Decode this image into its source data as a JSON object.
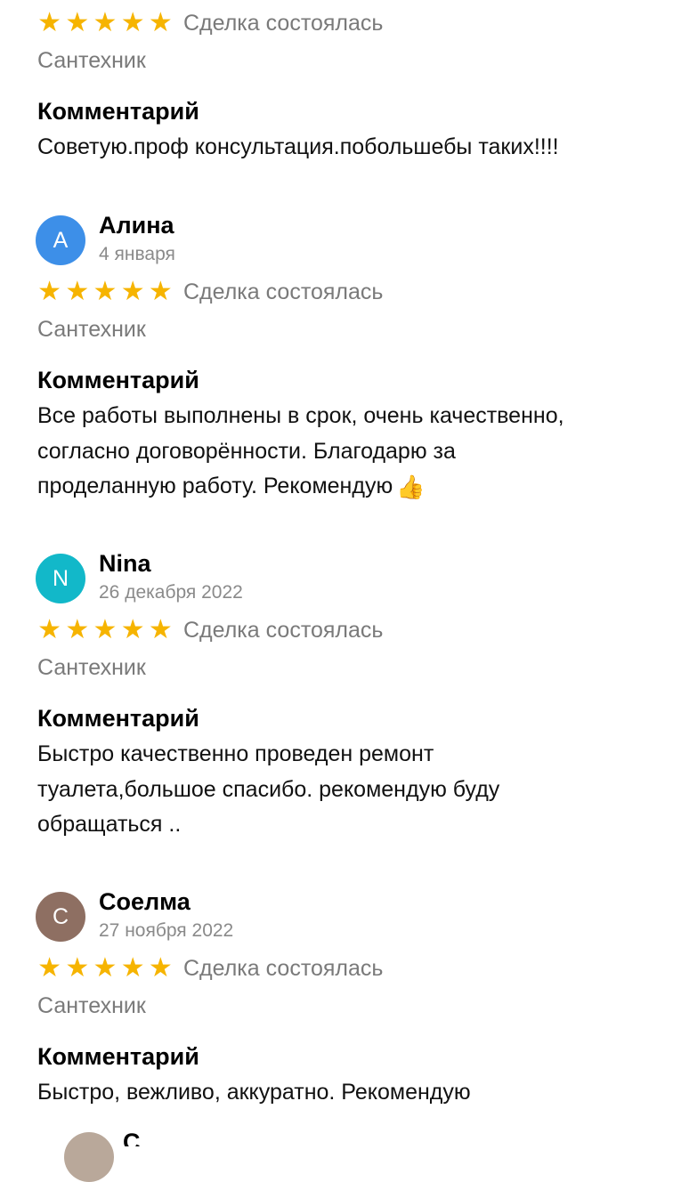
{
  "colors": {
    "star": "#f6b400",
    "secondary_text": "#7a7a7a",
    "avatar_alina": "#3d8fe8",
    "avatar_nina": "#12b8c9",
    "avatar_soelma": "#8e6f62"
  },
  "reviews": [
    {
      "rating": 5,
      "deal_status": "Сделка состоялась",
      "category": "Сантехник",
      "comment_heading": "Комментарий",
      "comment_lines": [
        "Советую.проф консультация.побольшебы таких!!!!"
      ]
    },
    {
      "avatar_letter": "А",
      "author": "Алина",
      "date": "4 января",
      "rating": 5,
      "deal_status": "Сделка состоялась",
      "category": "Сантехник",
      "comment_heading": "Комментарий",
      "comment_lines": [
        "Все работы выполнены в срок, очень качественно,",
        "согласно договорённости. Благодарю за",
        "проделанную работу. Рекомендую"
      ],
      "comment_emoji": "👍"
    },
    {
      "avatar_letter": "N",
      "author": "Nina",
      "date": "26 декабря 2022",
      "rating": 5,
      "deal_status": "Сделка состоялась",
      "category": "Сантехник",
      "comment_heading": "Комментарий",
      "comment_lines": [
        "Быстро качественно проведен ремонт",
        "туалета,большое спасибо. рекомендую буду",
        "обращаться .."
      ]
    },
    {
      "avatar_letter": "С",
      "author": "Соелма",
      "date": "27 ноября 2022",
      "rating": 5,
      "deal_status": "Сделка состоялась",
      "category": "Сантехник",
      "comment_heading": "Комментарий",
      "comment_lines": [
        "Быстро, вежливо, аккуратно. Рекомендую"
      ]
    }
  ],
  "next_review": {
    "author_initial": "С",
    "avatar_icon": "photo-avatar-icon"
  },
  "icons": {
    "star": "star-icon",
    "thumbs_up": "thumbs-up-emoji"
  }
}
